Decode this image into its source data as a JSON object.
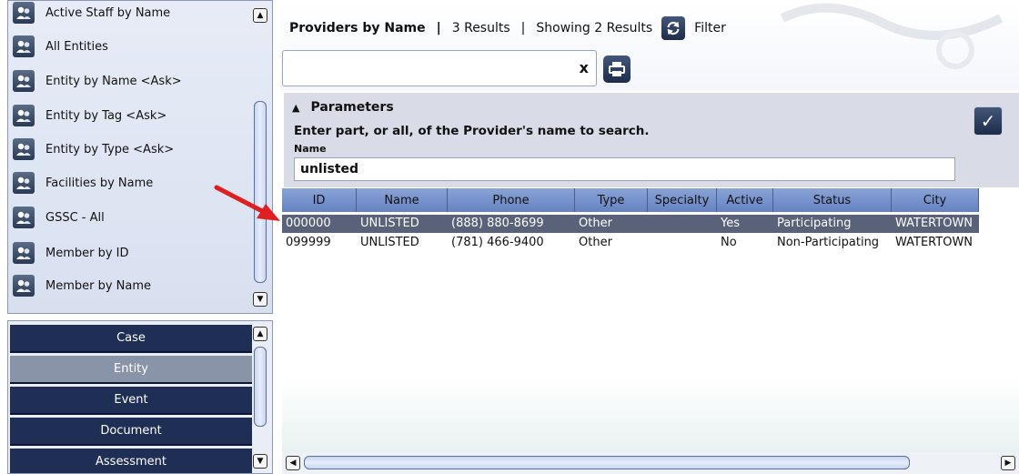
{
  "queries": {
    "items": [
      {
        "label": "Active Staff by Name"
      },
      {
        "label": "All Entities"
      },
      {
        "label": "Entity by Name <Ask>"
      },
      {
        "label": "Entity by Tag <Ask>"
      },
      {
        "label": "Entity by Type <Ask>"
      },
      {
        "label": "Facilities by Name"
      },
      {
        "label": "GSSC - All"
      },
      {
        "label": "Member by ID"
      },
      {
        "label": "Member by Name"
      }
    ]
  },
  "categories": {
    "items": [
      {
        "label": "Case"
      },
      {
        "label": "Entity",
        "selected": true
      },
      {
        "label": "Event"
      },
      {
        "label": "Document"
      },
      {
        "label": "Assessment"
      }
    ]
  },
  "header": {
    "title": "Providers by Name",
    "separator": "|",
    "results": "3 Results",
    "showing": "Showing 2 Results",
    "filter_label": "Filter"
  },
  "search": {
    "value": "",
    "clear_label": "x"
  },
  "parameters": {
    "toggle_label": "Parameters",
    "description": "Enter part, or all, of the Provider's name to search.",
    "name_label": "Name",
    "name_value": "unlisted"
  },
  "grid": {
    "columns": [
      "ID",
      "Name",
      "Phone",
      "Type",
      "Specialty",
      "Active",
      "Status",
      "City"
    ],
    "rows": [
      {
        "cells": [
          "000000",
          "UNLISTED",
          "(888) 880-8699",
          "Other",
          "",
          "Yes",
          "Participating",
          "WATERTOWN"
        ],
        "selected": true
      },
      {
        "cells": [
          "099999",
          "UNLISTED",
          "(781) 466-9400",
          "Other",
          "",
          "No",
          "Non-Participating",
          "WATERTOWN"
        ],
        "selected": false
      }
    ]
  },
  "colors": {
    "category_bg": "#1f2e54",
    "category_selected": "#8a94a8",
    "grid_header": "#7893cc",
    "row_selected": "#5a6279",
    "annotation_arrow": "#e02020"
  },
  "icons": {
    "query": "person-group-icon",
    "refresh": "refresh-icon",
    "print": "printer-icon",
    "apply": "checkmark-icon"
  }
}
